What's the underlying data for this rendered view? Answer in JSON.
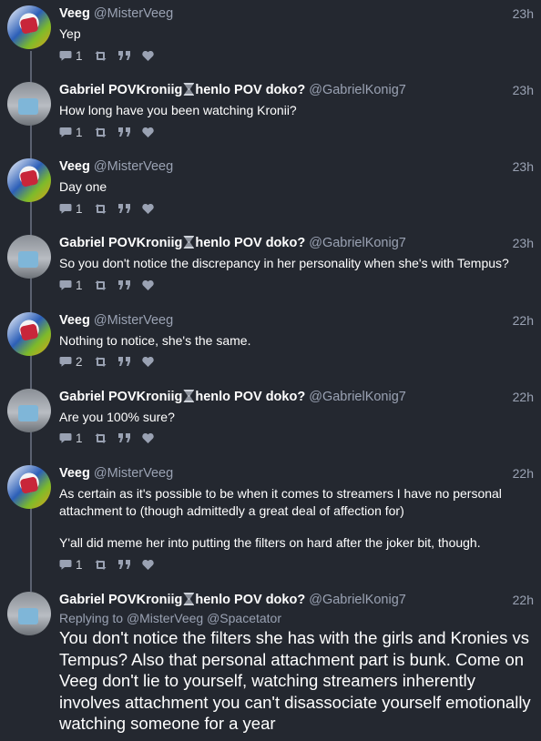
{
  "users": {
    "veeg": {
      "name": "Veeg",
      "handle": "@MisterVeeg"
    },
    "gabriel": {
      "name_prefix": "Gabriel POVKroniig",
      "name_suffix": "henlo POV doko?",
      "handle": "@GabrielKonig7"
    }
  },
  "tweets": [
    {
      "author": "veeg",
      "time": "23h",
      "text": "Yep",
      "replies": "1"
    },
    {
      "author": "gabriel",
      "time": "23h",
      "text": "How long have you been watching Kronii?",
      "replies": "1"
    },
    {
      "author": "veeg",
      "time": "23h",
      "text": "Day one",
      "replies": "1"
    },
    {
      "author": "gabriel",
      "time": "23h",
      "text": "So you don't notice the discrepancy in her personality when she's with Tempus?",
      "replies": "1"
    },
    {
      "author": "veeg",
      "time": "22h",
      "text": "Nothing to notice, she's the same.",
      "replies": "2"
    },
    {
      "author": "gabriel",
      "time": "22h",
      "text": "Are you 100% sure?",
      "replies": "1"
    },
    {
      "author": "veeg",
      "time": "22h",
      "text": "As certain as it's possible to be when it comes to streamers I have no personal attachment to (though admittedly a great deal of affection for)",
      "text2": "Y'all did meme her into putting the filters on hard after the joker bit, though.",
      "replies": "1"
    },
    {
      "author": "gabriel",
      "time": "22h",
      "replying_label": "Replying to",
      "replying_to": "@MisterVeeg @Spacetator",
      "text": "You don't notice the filters she has with the girls and Kronies vs Tempus? Also that personal attachment part is bunk. Come on Veeg don't lie to yourself, watching streamers inherently involves attachment you can't disassociate yourself emotionally watching someone for a year"
    }
  ],
  "icons": {
    "reply": "reply-icon",
    "retweet": "retweet-icon",
    "quote": "quote-icon",
    "like": "heart-icon",
    "hourglass": "hourglass-emoji"
  },
  "colors": {
    "background": "#242830",
    "muted": "#9aa2b3",
    "thread_line": "#5b6170"
  }
}
